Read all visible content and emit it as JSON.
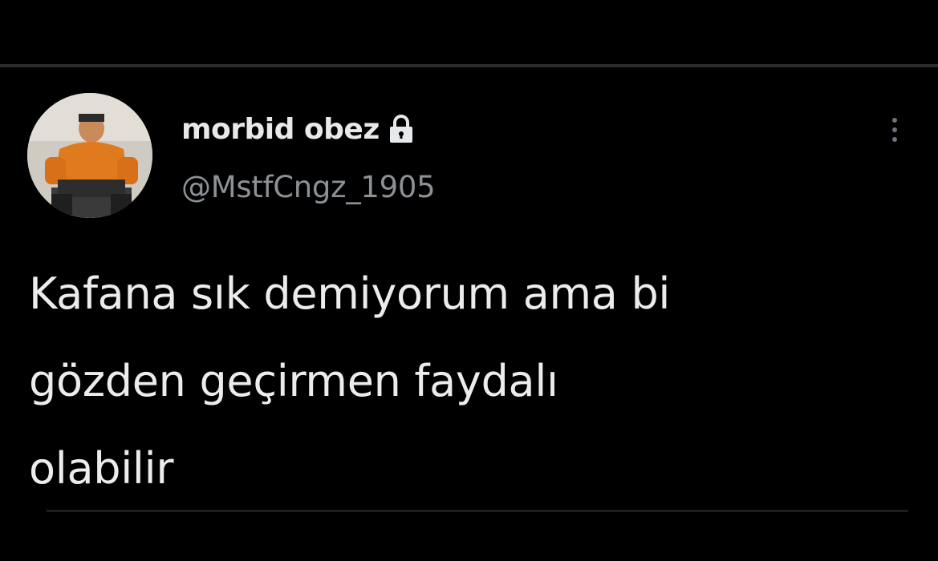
{
  "user": {
    "display_name": "morbid obez",
    "handle": "@MstfCngz_1905",
    "protected_icon": "lock-icon",
    "avatar_icon": "avatar-photo"
  },
  "tweet": {
    "text_lines": [
      "Kafana sık demiyorum ama bi",
      "gözden geçirmen faydalı",
      "olabilir"
    ]
  },
  "menu": {
    "more_icon": "more-vertical-icon"
  },
  "colors": {
    "background": "#000000",
    "primary_text": "#e7e9ea",
    "secondary_text": "#8b9196",
    "divider": "#2a2c2e"
  }
}
